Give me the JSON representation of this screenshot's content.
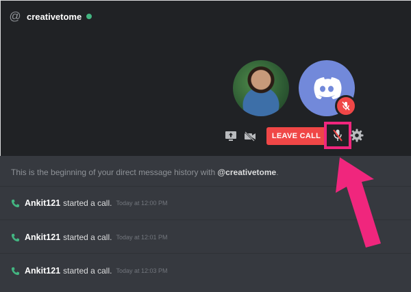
{
  "header": {
    "username": "creativetome",
    "status_color": "#43b581"
  },
  "call": {
    "leave_label": "LEAVE CALL",
    "leave_color": "#f04747",
    "highlight_color": "#f0267d"
  },
  "intro": {
    "prefix": "This is the beginning of your direct message history with ",
    "mention": "@creativetome",
    "suffix": "."
  },
  "messages": [
    {
      "user": "Ankit121",
      "text": "started a call.",
      "time": "Today at 12:00 PM"
    },
    {
      "user": "Ankit121",
      "text": "started a call.",
      "time": "Today at 12:01 PM"
    },
    {
      "user": "Ankit121",
      "text": "started a call.",
      "time": "Today at 12:03 PM"
    }
  ],
  "icons": [
    "at-icon",
    "screen-share-icon",
    "video-off-icon",
    "mic-muted-icon",
    "settings-icon",
    "phone-icon",
    "discord-logo-icon"
  ]
}
